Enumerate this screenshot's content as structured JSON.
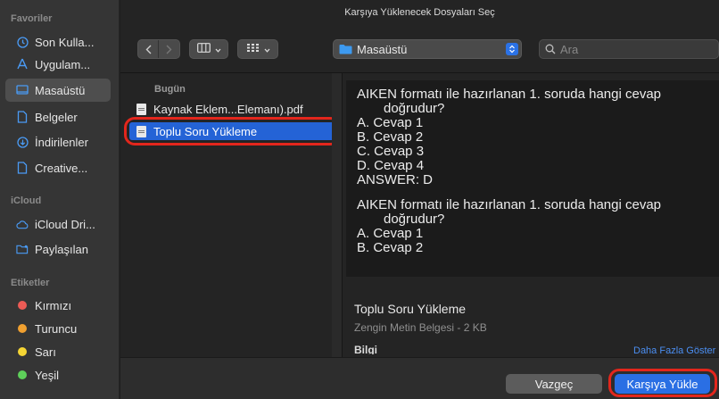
{
  "window_title": "Karşıya Yüklenecek Dosyaları Seç",
  "sidebar": {
    "favorites_header": "Favoriler",
    "favorites": [
      {
        "label": "Son Kulla...",
        "icon": "clock-icon"
      },
      {
        "label": "Uygulam...",
        "icon": "applications-icon"
      },
      {
        "label": "Masaüstü",
        "icon": "desktop-icon",
        "active": true
      },
      {
        "label": "Belgeler",
        "icon": "document-icon"
      },
      {
        "label": "İndirilenler",
        "icon": "download-icon"
      },
      {
        "label": "Creative...",
        "icon": "file-icon"
      }
    ],
    "icloud_header": "iCloud",
    "icloud": [
      {
        "label": "iCloud Dri...",
        "icon": "cloud-icon"
      },
      {
        "label": "Paylaşılan",
        "icon": "shared-folder-icon"
      }
    ],
    "tags_header": "Etiketler",
    "tags": [
      {
        "label": "Kırmızı",
        "color": "#ec5b55"
      },
      {
        "label": "Turuncu",
        "color": "#f0a030"
      },
      {
        "label": "Sarı",
        "color": "#f5d534"
      },
      {
        "label": "Yeşil",
        "color": "#5ed05a"
      }
    ]
  },
  "toolbar": {
    "location": "Masaüstü",
    "search_placeholder": "Ara"
  },
  "filelist": {
    "group": "Bugün",
    "files": [
      {
        "name": "Kaynak Eklem...Elemanı).pdf",
        "selected": false
      },
      {
        "name": "Toplu Soru Yükleme",
        "selected": true
      }
    ]
  },
  "preview": {
    "block1": {
      "q1": "AIKEN formatı ile hazırlanan 1. soruda hangi cevap",
      "q2": "doğrudur?",
      "a": "A. Cevap 1",
      "b": "B. Cevap 2",
      "c": "C. Cevap 3",
      "d": "D. Cevap 4",
      "answer": "ANSWER: D"
    },
    "block2": {
      "q1": "AIKEN formatı ile hazırlanan 1. soruda hangi cevap",
      "q2": "doğrudur?",
      "a": "A. Cevap 1",
      "b": "B. Cevap 2"
    },
    "name": "Toplu Soru Yükleme",
    "kind": "Zengin Metin Belgesi - 2 KB",
    "info": "Bilgi",
    "more": "Daha Fazla Göster"
  },
  "buttons": {
    "cancel": "Vazgeç",
    "upload": "Karşıya Yükle"
  },
  "colors": {
    "accent": "#2a6fe4",
    "highlight": "#e3261c"
  }
}
